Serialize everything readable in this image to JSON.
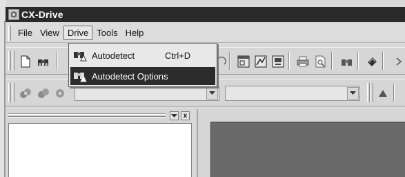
{
  "window": {
    "title": "CX-Drive"
  },
  "menu": {
    "items": [
      {
        "label": "File"
      },
      {
        "label": "View"
      },
      {
        "label": "Drive",
        "open": true
      },
      {
        "label": "Tools"
      },
      {
        "label": "Help"
      }
    ]
  },
  "drive_menu": {
    "items": [
      {
        "label": "Autodetect",
        "shortcut": "Ctrl+D",
        "icon": "binoculars-warning-icon",
        "selected": false
      },
      {
        "label": "Autodetect Options",
        "shortcut": "",
        "icon": "binoculars-warning-icon",
        "selected": true
      }
    ]
  },
  "panel": {
    "close_label": "x"
  }
}
